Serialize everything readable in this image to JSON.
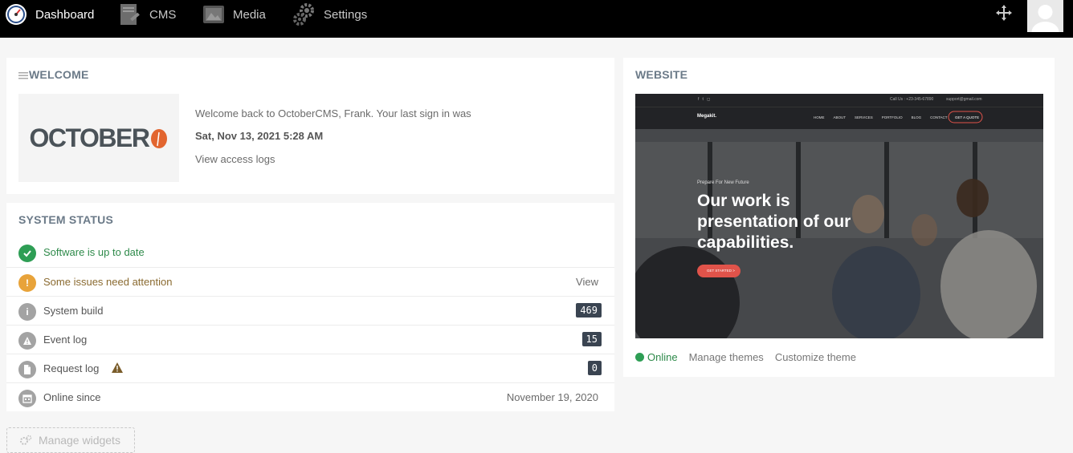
{
  "nav": {
    "items": [
      {
        "label": "Dashboard",
        "icon": "dashboard-gauge-icon"
      },
      {
        "label": "CMS",
        "icon": "cms-icon"
      },
      {
        "label": "Media",
        "icon": "media-icon"
      },
      {
        "label": "Settings",
        "icon": "settings-gear-icon"
      }
    ],
    "right_icon": "move-arrows-icon"
  },
  "welcome": {
    "title": "WELCOME",
    "logo_text": "OCTOBER",
    "message": "Welcome back to OctoberCMS, Frank. Your last sign in was",
    "last_signin": "Sat, Nov 13, 2021 5:28 AM",
    "access_logs_link": "View access logs"
  },
  "system_status": {
    "title": "SYSTEM STATUS",
    "rows": [
      {
        "label": "Software is up to date",
        "icon": "check-icon",
        "color": "#2e9e55"
      },
      {
        "label": "Some issues need attention",
        "icon": "exclamation-icon",
        "color": "#e8a33a",
        "action": "View"
      },
      {
        "label": "System build",
        "icon": "info-icon",
        "value": "469"
      },
      {
        "label": "Event log",
        "icon": "warning-triangle-icon",
        "value": "15"
      },
      {
        "label": "Request log",
        "icon": "document-icon",
        "value": "0"
      },
      {
        "label": "Online since",
        "icon": "calendar-icon",
        "value": "November 19, 2020"
      }
    ]
  },
  "website": {
    "title": "WEBSITE",
    "preview": {
      "contact_phone": "Call Us : +23-345-67890",
      "contact_email": "support@gmail.com",
      "brand": "Megakit.",
      "menu": [
        "HOME",
        "ABOUT",
        "SERVICES",
        "PORTFOLIO",
        "BLOG",
        "CONTACT"
      ],
      "cta": "GET A QUOTE",
      "kicker": "Prepare For New Future",
      "headline": "Our work is presentation of our capabilities.",
      "button": "GET STARTED >"
    },
    "status": "Online",
    "status_color": "#2e9e55",
    "links": [
      "Manage themes",
      "Customize theme"
    ]
  },
  "manage_widgets": "Manage widgets"
}
